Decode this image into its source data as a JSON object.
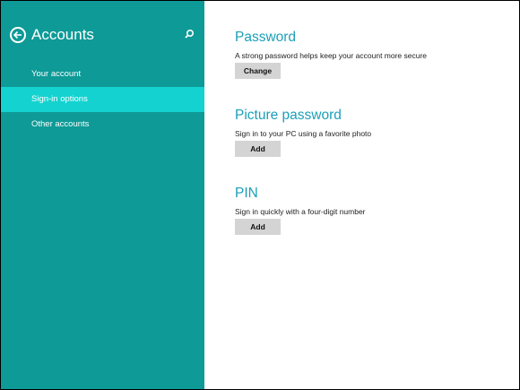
{
  "sidebar": {
    "title": "Accounts",
    "back_icon": "back-arrow-circle-icon",
    "search_icon": "search-icon",
    "items": [
      {
        "label": "Your account",
        "selected": false
      },
      {
        "label": "Sign-in options",
        "selected": true
      },
      {
        "label": "Other accounts",
        "selected": false
      }
    ]
  },
  "main": {
    "sections": [
      {
        "title": "Password",
        "description": "A strong password helps keep your account more secure",
        "button_label": "Change"
      },
      {
        "title": "Picture password",
        "description": "Sign in to your PC using a favorite photo",
        "button_label": "Add"
      },
      {
        "title": "PIN",
        "description": "Sign in quickly with a four-digit number",
        "button_label": "Add"
      }
    ]
  },
  "colors": {
    "sidebar_bg": "#0e9a97",
    "selected_item_bg": "#14d2cf",
    "accent_title": "#1b9fb8",
    "button_bg": "#d4d4d4",
    "content_bg": "#ffffff"
  }
}
